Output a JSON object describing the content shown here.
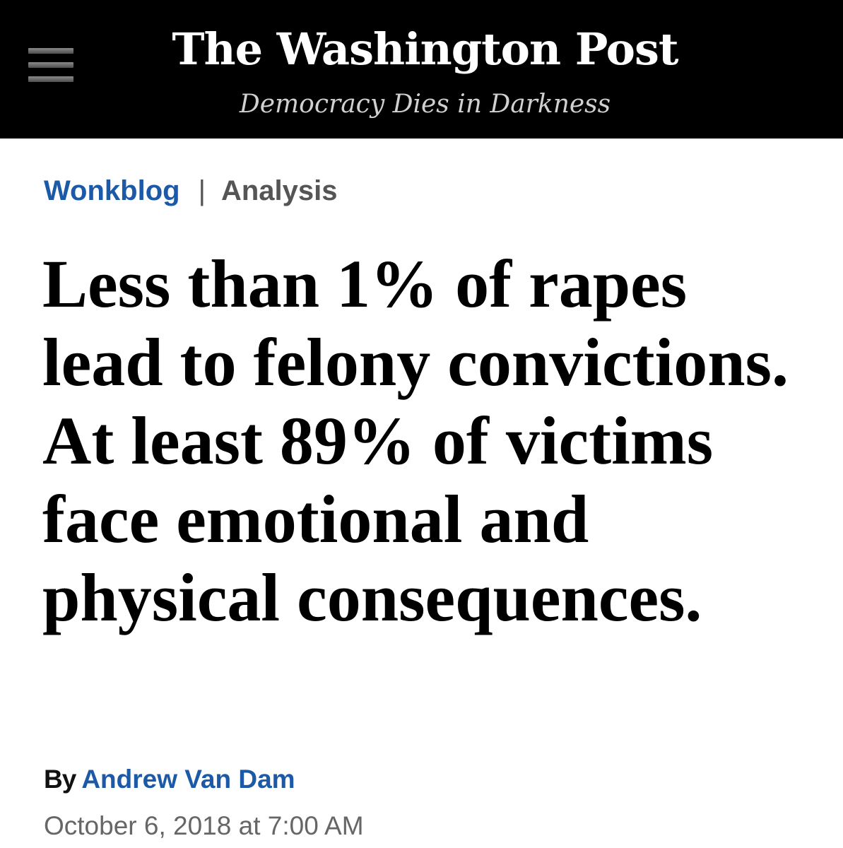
{
  "masthead": {
    "logo": "The Washington Post",
    "tagline": "Democracy Dies in Darkness",
    "menu_icon": "hamburger-menu-icon",
    "background_color": "#000000"
  },
  "kicker": {
    "section": "Wonkblog",
    "separator": "|",
    "label": "Analysis",
    "section_color": "#1c59a6"
  },
  "article": {
    "headline": "Less than 1% of rapes lead to felony convictions. At least 89% of victims face emotional and physical consequences.",
    "byline_prefix": "By",
    "author": "Andrew Van Dam",
    "timestamp": "October 6, 2018 at 7:00 AM"
  }
}
